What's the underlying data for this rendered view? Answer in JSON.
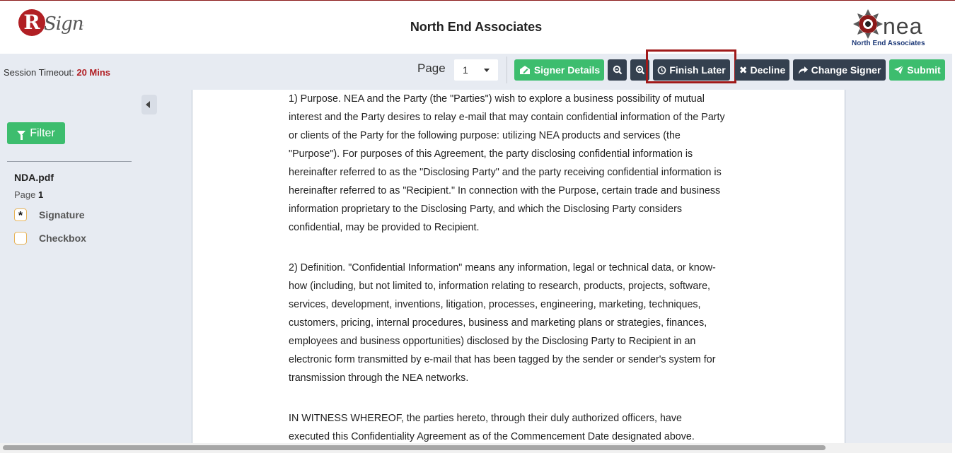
{
  "header": {
    "app_logo_letter": "R",
    "app_logo_text": "Sign",
    "app_logo_tm": "™",
    "title": "North End Associates",
    "company_logo_text": "nea",
    "company_logo_subtitle": "North End Associates"
  },
  "toolbar": {
    "session_label": "Session Timeout:",
    "session_value": "20 Mins",
    "page_label": "Page",
    "page_select_value": "1",
    "buttons": {
      "signer_details": "Signer Details",
      "finish_later": "Finish Later",
      "decline": "Decline",
      "change_signer": "Change Signer",
      "submit": "Submit"
    }
  },
  "sidebar": {
    "filter_label": "Filter",
    "file_name": "NDA.pdf",
    "page_prefix": "Page",
    "page_number": "1",
    "fields": [
      {
        "label": "Signature",
        "marker": "*"
      },
      {
        "label": "Checkbox",
        "marker": ""
      }
    ]
  },
  "document": {
    "para1": [
      "1) Purpose.  NEA and the Party (the \"Parties\") wish to explore a business possibility of mutual",
      "interest and the Party desires to relay e-mail that may contain confidential information of the Party",
      "or clients of the Party for the following purpose: utilizing NEA products and services (the",
      "\"Purpose\").  For purposes of this Agreement, the party disclosing confidential information is",
      "hereinafter referred to as the \"Disclosing Party\" and the party receiving confidential information is",
      "hereinafter referred to as \"Recipient.\"  In connection with the Purpose, certain trade and business",
      "information proprietary to the Disclosing Party, and which the Disclosing Party considers",
      "confidential, may be provided to Recipient."
    ],
    "para2": [
      "2) Definition.  \"Confidential Information\" means any information, legal or technical data, or know-",
      "how (including, but not limited to, information relating to research, products, projects, software,",
      "services, development, inventions, litigation, processes, engineering, marketing, techniques,",
      "customers, pricing, internal procedures, business and marketing plans or strategies, finances,",
      "employees and business opportunities) disclosed by the Disclosing Party to Recipient in an",
      "electronic form transmitted by e-mail that has been tagged by the sender or sender's system for",
      "transmission through the NEA networks."
    ],
    "para3": [
      "IN WITNESS WHEREOF, the parties hereto, through their duly authorized officers, have",
      "executed this Confidentiality Agreement as of the Commencement Date designated above."
    ]
  },
  "colors": {
    "brand_red": "#b11f24",
    "green": "#3dbd6e",
    "dark": "#34404f",
    "highlight": "#a01a1a"
  }
}
